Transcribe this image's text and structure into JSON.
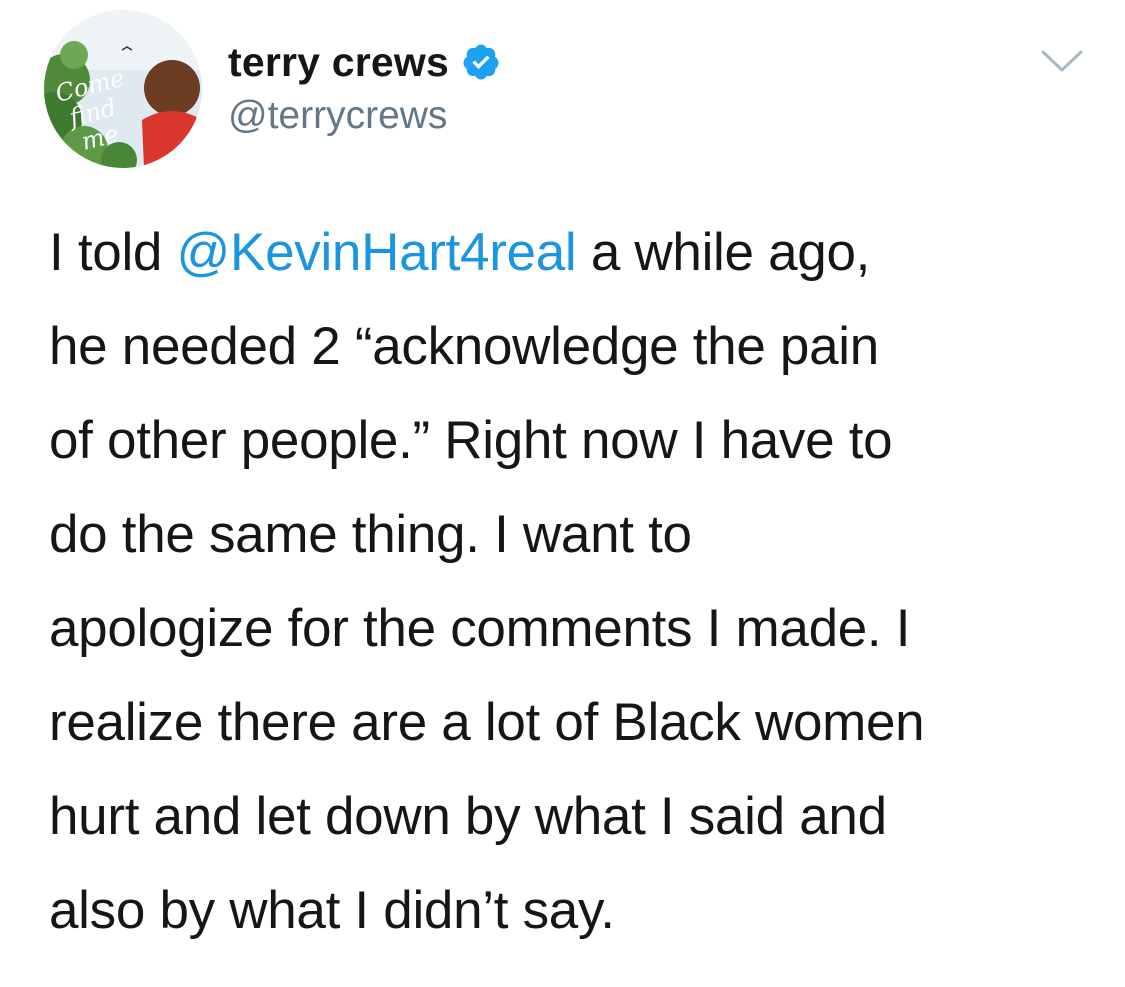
{
  "author": {
    "display_name": "terry crews",
    "handle": "@terrycrews",
    "verified": true,
    "avatar_text": [
      "Come",
      "find",
      "me"
    ]
  },
  "tweet": {
    "lines": [
      {
        "before": "I told ",
        "mention": "@KevinHart4real",
        "after": " a while ago,"
      },
      {
        "text": "he needed 2 “acknowledge the pain"
      },
      {
        "text": "of other people.” Right now I have to"
      },
      {
        "text": "do the same thing. I want to"
      },
      {
        "text": "apologize for the comments I made. I"
      },
      {
        "text": "realize there are a lot of Black women"
      },
      {
        "text": "hurt and let down by what I said and"
      },
      {
        "text": "also by what I didn’t say."
      }
    ]
  },
  "colors": {
    "text": "#14171a",
    "secondary": "#657786",
    "link": "#1b95e0",
    "verified_badge": "#1da1f2"
  },
  "icons": {
    "verified": "verified-badge-icon",
    "menu": "chevron-down-icon"
  }
}
